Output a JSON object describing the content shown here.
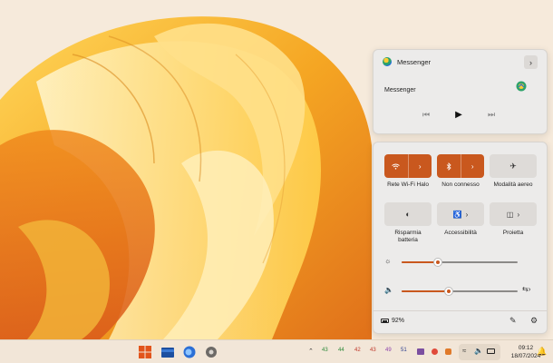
{
  "media": {
    "app_name": "Messenger",
    "title": "Messenger",
    "expand_icon": "chevron-right-icon",
    "prev_icon": "previous-icon",
    "play_icon": "play-icon",
    "next_icon": "next-icon"
  },
  "quick_settings": {
    "tiles": [
      {
        "label": "Rete Wi-Fi Halo",
        "icon": "wifi-icon",
        "state": "on"
      },
      {
        "label": "Non connesso",
        "icon": "bluetooth-icon",
        "state": "on"
      },
      {
        "label": "Modalità aereo",
        "icon": "airplane-icon",
        "state": "off"
      },
      {
        "label": "Risparmia\nbatteria",
        "icon": "battery-saver-icon",
        "state": "off"
      },
      {
        "label": "Accessibilità",
        "icon": "accessibility-icon",
        "state": "off"
      },
      {
        "label": "Proietta",
        "icon": "cast-icon",
        "state": "off"
      }
    ],
    "brightness": {
      "icon": "brightness-icon",
      "level": 0.31
    },
    "volume": {
      "icon": "speaker-icon",
      "level": 0.41,
      "output_icon": "audio-output-icon"
    },
    "battery": {
      "percent": "92%",
      "icon": "battery-icon"
    },
    "edit_icon": "pencil-icon",
    "settings_icon": "gear-icon"
  },
  "taskbar": {
    "apps": [
      "windows-start-icon",
      "file-explorer-icon",
      "firefox-icon",
      "settings-icon"
    ],
    "tray_numbers": [
      "43",
      "44",
      "42",
      "43",
      "49",
      "51"
    ],
    "time": "09:12",
    "date": "18/07/2024"
  },
  "colors": {
    "accent": "#c9581e",
    "panel": "#ecebea",
    "taskbar": "#f2e6d8"
  }
}
